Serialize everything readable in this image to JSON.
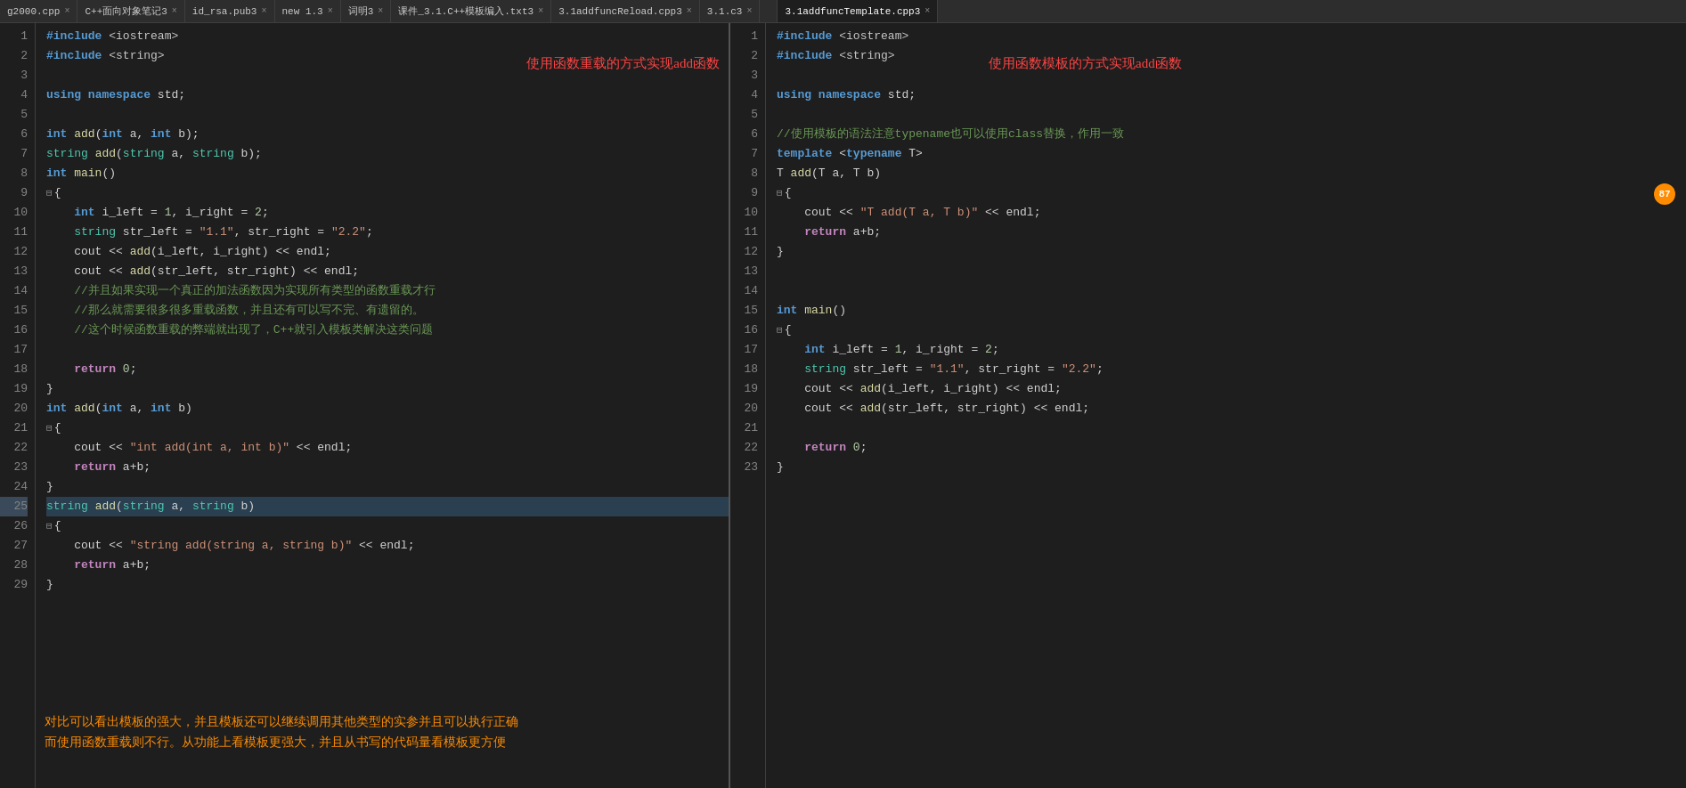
{
  "tabs": {
    "left_tabs": [
      {
        "label": "g2000.cpp",
        "active": false
      },
      {
        "label": "C++面向对象笔记3",
        "active": false
      },
      {
        "label": "id_rsa.pub3",
        "active": false
      },
      {
        "label": "new 1.3",
        "active": false
      },
      {
        "label": "词明3",
        "active": false
      },
      {
        "label": "课件_3.1.C++模板编入.txt3",
        "active": false
      },
      {
        "label": "3.1addfuncReload.cpp3",
        "active": false
      },
      {
        "label": "3.1.c3",
        "active": false
      }
    ],
    "right_tabs": [
      {
        "label": "3.1addfuncTemplate.cpp3",
        "active": true
      }
    ]
  },
  "left_editor": {
    "title": "3.1addfuncReload.cpp",
    "annotation_top": "使用函数重载的方式实现add函数",
    "annotation_bottom_line1": "对比可以看出模板的强大，并且模板还可以继续调用其他类型的实参并且可以执行正确",
    "annotation_bottom_line2": "而使用函数重载则不行。从功能上看模板更强大，并且从书写的代码量看模板更方便",
    "lines": [
      {
        "n": 1,
        "code": "#include <iostream>"
      },
      {
        "n": 2,
        "code": "#include <string>"
      },
      {
        "n": 3,
        "code": ""
      },
      {
        "n": 4,
        "code": "using namespace std;"
      },
      {
        "n": 5,
        "code": ""
      },
      {
        "n": 6,
        "code": "int add(int a, int b);"
      },
      {
        "n": 7,
        "code": "string add(string a, string b);"
      },
      {
        "n": 8,
        "code": "int main()"
      },
      {
        "n": 9,
        "code": "{"
      },
      {
        "n": 10,
        "code": "    int i_left = 1, i_right = 2;"
      },
      {
        "n": 11,
        "code": "    string str_left = \"1.1\", str_right = \"2.2\";"
      },
      {
        "n": 12,
        "code": "    cout << add(i_left, i_right) << endl;"
      },
      {
        "n": 13,
        "code": "    cout << add(str_left, str_right) << endl;"
      },
      {
        "n": 14,
        "code": "    //并且如果实现一个真正的加法函数因为实现所有类型的函数重载才行"
      },
      {
        "n": 15,
        "code": "    //那么就需要很多很多重载函数，并且还有可以写不完、有遗留的。"
      },
      {
        "n": 16,
        "code": "    //这个时候函数重载的弊端就出现了，C++就引入模板类解决这类问题"
      },
      {
        "n": 17,
        "code": ""
      },
      {
        "n": 18,
        "code": "    return 0;"
      },
      {
        "n": 19,
        "code": "}"
      },
      {
        "n": 20,
        "code": "int add(int a, int b)"
      },
      {
        "n": 21,
        "code": "{"
      },
      {
        "n": 22,
        "code": "    cout << \"int add(int a, int b)\" << endl;"
      },
      {
        "n": 23,
        "code": "    return a+b;"
      },
      {
        "n": 24,
        "code": "}"
      },
      {
        "n": 25,
        "code": "string add(string a, string b)"
      },
      {
        "n": 26,
        "code": "{"
      },
      {
        "n": 27,
        "code": "    cout << \"string add(string a, string b)\" << endl;"
      },
      {
        "n": 28,
        "code": "    return a+b;"
      },
      {
        "n": 29,
        "code": "}"
      }
    ]
  },
  "right_editor": {
    "title": "3.1addfuncTemplate.cpp",
    "annotation_top": "使用函数模板的方式实现add函数",
    "lines": [
      {
        "n": 1,
        "code": "#include <iostream>"
      },
      {
        "n": 2,
        "code": "#include <string>"
      },
      {
        "n": 3,
        "code": ""
      },
      {
        "n": 4,
        "code": "using namespace std;"
      },
      {
        "n": 5,
        "code": ""
      },
      {
        "n": 6,
        "code": "//使用模板的语法注意typename也可以使用class替换，作用一致"
      },
      {
        "n": 7,
        "code": "template <typename T>"
      },
      {
        "n": 8,
        "code": "T add(T a, T b)"
      },
      {
        "n": 9,
        "code": "{"
      },
      {
        "n": 10,
        "code": "    cout << \"T add(T a, T b)\" << endl;"
      },
      {
        "n": 11,
        "code": "    return a+b;"
      },
      {
        "n": 12,
        "code": "}"
      },
      {
        "n": 13,
        "code": ""
      },
      {
        "n": 14,
        "code": ""
      },
      {
        "n": 15,
        "code": "int main()"
      },
      {
        "n": 16,
        "code": "{"
      },
      {
        "n": 17,
        "code": "    int i_left = 1, i_right = 2;"
      },
      {
        "n": 18,
        "code": "    string str_left = \"1.1\", str_right = \"2.2\";"
      },
      {
        "n": 19,
        "code": "    cout << add(i_left, i_right) << endl;"
      },
      {
        "n": 20,
        "code": "    cout << add(str_left, str_right) << endl;"
      },
      {
        "n": 21,
        "code": ""
      },
      {
        "n": 22,
        "code": "    return 0;"
      },
      {
        "n": 23,
        "code": "}"
      }
    ]
  }
}
